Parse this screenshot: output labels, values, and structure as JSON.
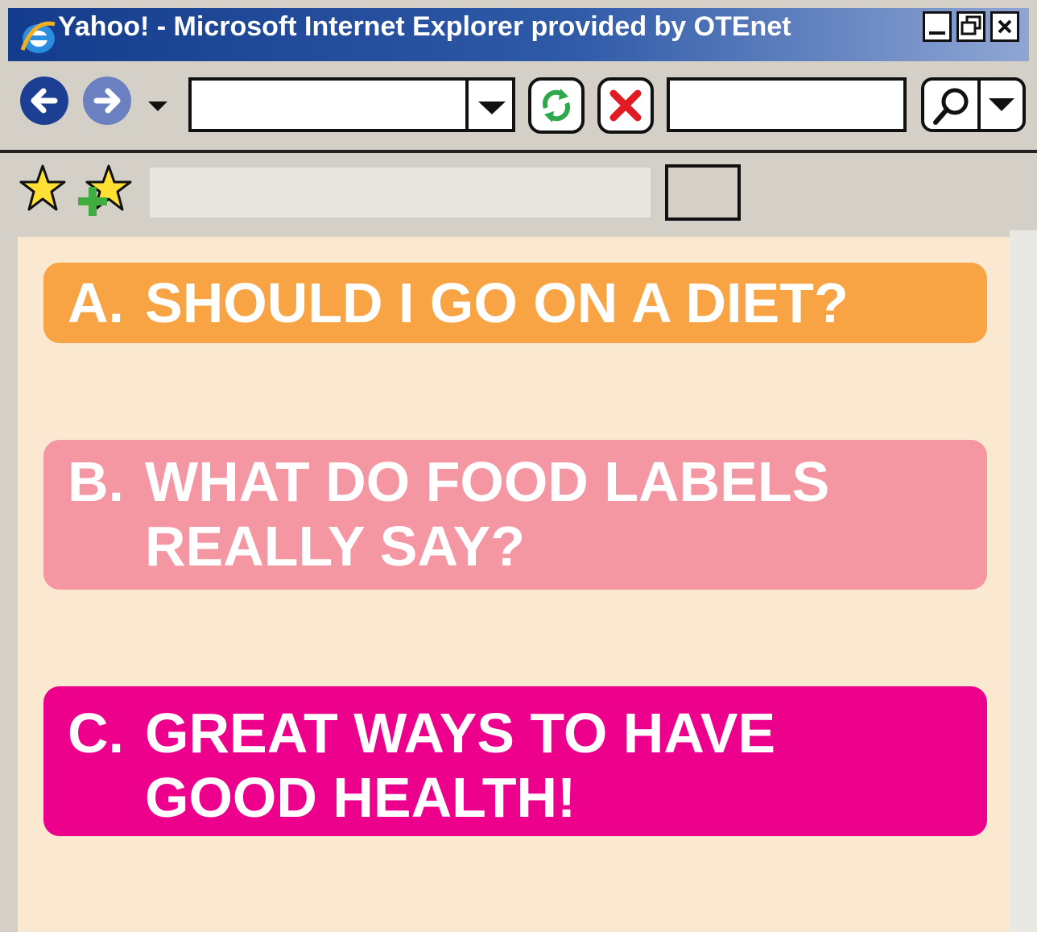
{
  "window": {
    "title": "Yahoo! - Microsoft Internet Explorer provided by OTEnet",
    "icon": "ie-logo-icon"
  },
  "toolbar": {
    "back": "back-arrow-icon",
    "forward": "forward-arrow-icon",
    "address_value": "",
    "search_value": ""
  },
  "favorites": {
    "tab_value": ""
  },
  "menu": {
    "a_letter": "A.",
    "a_text": "SHOULD I GO ON A DIET?",
    "b_letter": "B.",
    "b_line1": "WHAT DO FOOD LABELS",
    "b_line2": "REALLY SAY?",
    "c_letter": "C.",
    "c_line1": "GREAT WAYS TO HAVE",
    "c_line2": "GOOD HEALTH!"
  },
  "colors": {
    "card_a": "#f9a444",
    "card_b": "#f497a2",
    "card_c": "#ec008c",
    "content_bg": "#fbe8d1"
  }
}
